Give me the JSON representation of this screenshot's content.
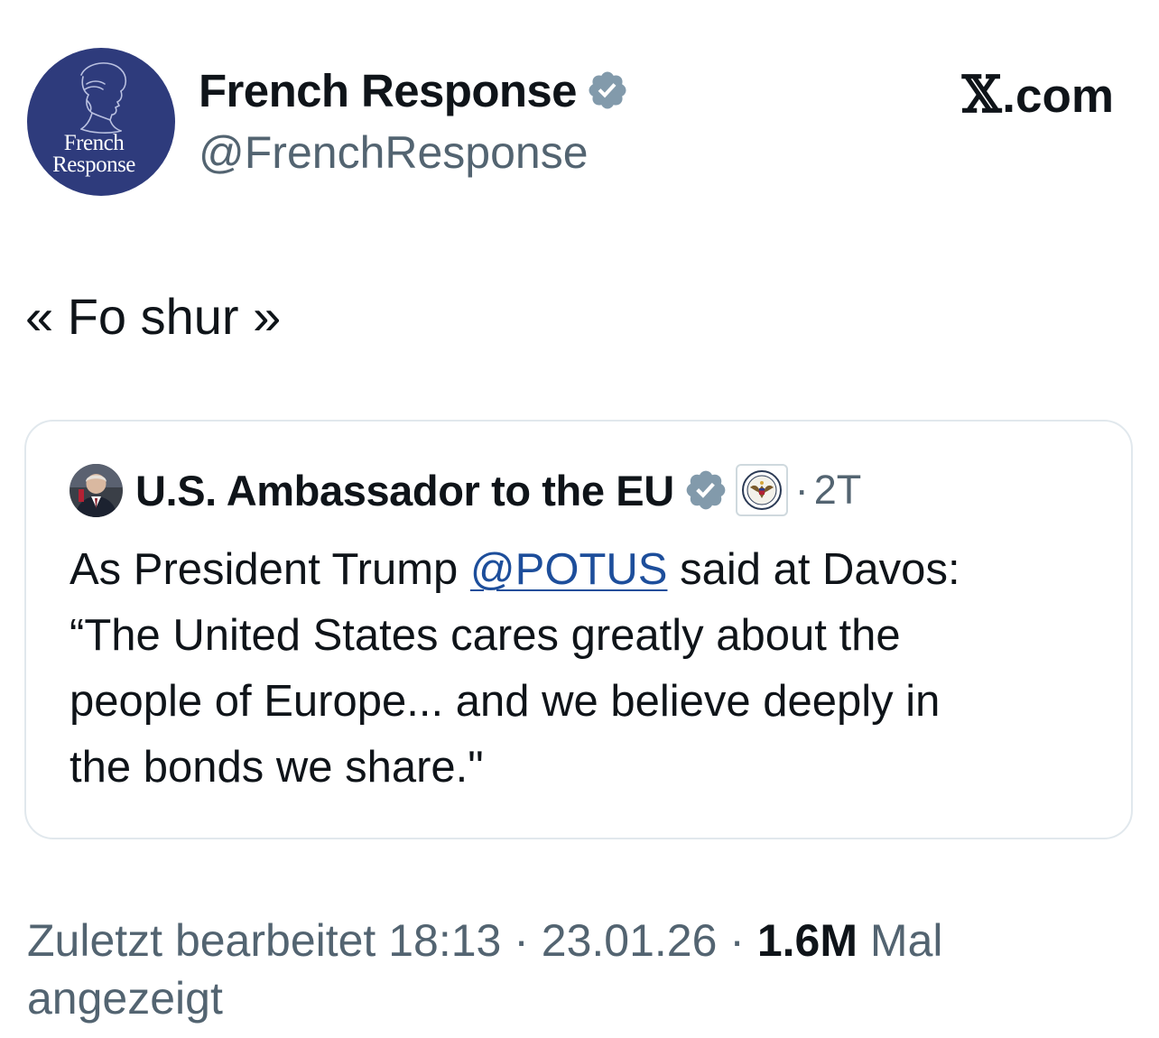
{
  "author": {
    "display_name": "French Response",
    "handle": "@FrenchResponse",
    "avatar_logo_line1": "French",
    "avatar_logo_line2": "Response",
    "verified": true,
    "avatar_color": "#2e3b7c"
  },
  "brand": {
    "logo": "𝕏",
    "suffix": ".com"
  },
  "tweet": {
    "text": "« Fo shur »"
  },
  "quote": {
    "author_name": "U.S. Ambassador to the EU",
    "verified": true,
    "affiliation_icon": "state-department-seal-icon",
    "separator": "·",
    "time": "2T",
    "text_line1_before": "As President Trump ",
    "mention": "@POTUS",
    "text_line1_after": " said at Davos:",
    "text_line2": "“The United States cares greatly about the",
    "text_line3": "people of Europe... and we believe deeply in",
    "text_line4": "the bonds we share.\""
  },
  "meta": {
    "edited_label": "Zuletzt bearbeitet 18:13 · 23.01.26 ",
    "separator": "·",
    "views_count": "1.6M",
    "views_suffix": " Mal",
    "views_line2": "angezeigt"
  },
  "colors": {
    "text_primary": "#0f1419",
    "text_secondary": "#536471",
    "mention": "#1d4e9b",
    "verified_badge": "#829aab",
    "card_border": "#e1e8ed"
  }
}
